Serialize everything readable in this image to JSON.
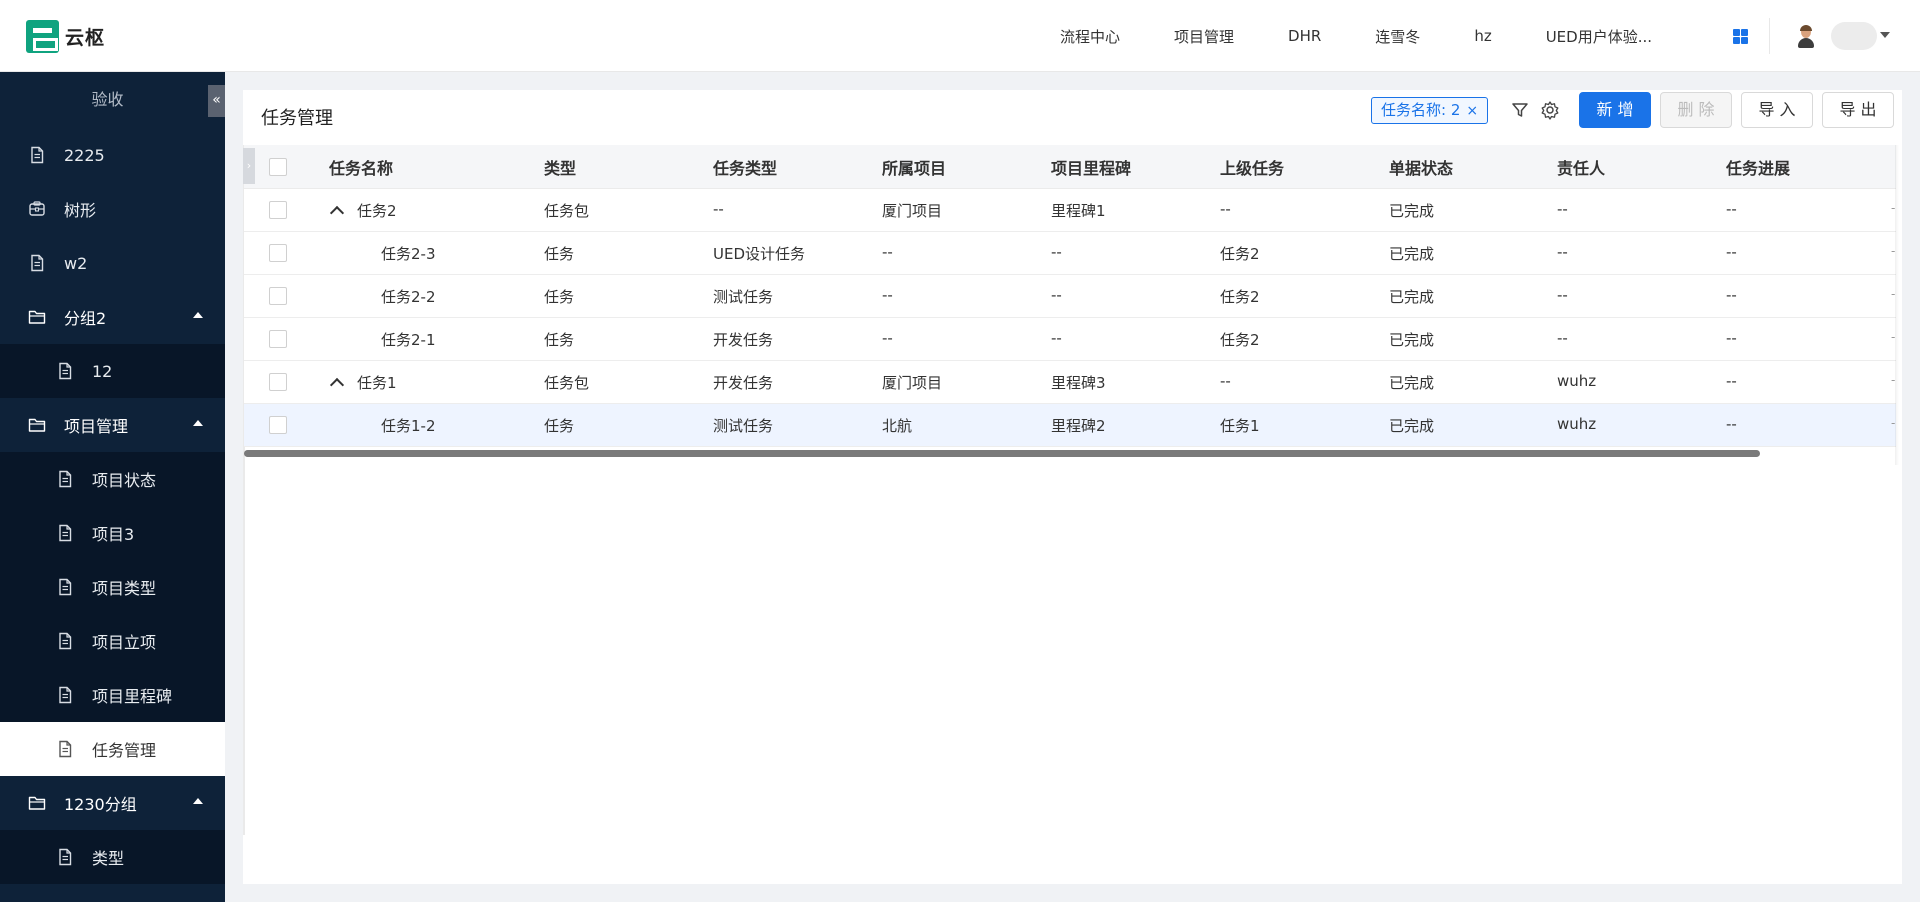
{
  "app": {
    "logo_text": "云枢"
  },
  "topnav": {
    "items": [
      "流程中心",
      "项目管理",
      "DHR",
      "连雪冬",
      "hz",
      "UED用户体验..."
    ]
  },
  "sidebar": {
    "title": "验收",
    "collapse_glyph": "«",
    "items": [
      {
        "label": "2225",
        "icon": "document-icon",
        "level": 0
      },
      {
        "label": "树形",
        "icon": "tree-icon",
        "level": 0
      },
      {
        "label": "w2",
        "icon": "document-icon",
        "level": 0
      },
      {
        "label": "分组2",
        "icon": "folder-icon",
        "level": 0,
        "group": true,
        "expanded": true
      },
      {
        "label": "12",
        "icon": "document-icon",
        "level": 1
      },
      {
        "label": "项目管理",
        "icon": "folder-icon",
        "level": 0,
        "group": true,
        "expanded": true
      },
      {
        "label": "项目状态",
        "icon": "document-icon",
        "level": 1
      },
      {
        "label": "项目3",
        "icon": "document-icon",
        "level": 1
      },
      {
        "label": "项目类型",
        "icon": "document-icon",
        "level": 1
      },
      {
        "label": "项目立项",
        "icon": "document-icon",
        "level": 1
      },
      {
        "label": "项目里程碑",
        "icon": "document-icon",
        "level": 1
      },
      {
        "label": "任务管理",
        "icon": "document-icon",
        "level": 1,
        "active": true
      },
      {
        "label": "1230分组",
        "icon": "folder-icon",
        "level": 0,
        "group": true,
        "expanded": true
      },
      {
        "label": "类型",
        "icon": "document-icon",
        "level": 1
      }
    ]
  },
  "page": {
    "title": "任务管理",
    "filter_chip": "任务名称: 2",
    "filter_chip_close": "×",
    "buttons": {
      "add": "新 增",
      "delete": "删 除",
      "import": "导 入",
      "export": "导 出"
    }
  },
  "table": {
    "columns": [
      "任务名称",
      "类型",
      "任务类型",
      "所属项目",
      "项目里程碑",
      "上级任务",
      "单据状态",
      "责任人",
      "任务进展"
    ],
    "rows": [
      {
        "name": "任务2",
        "type": "任务包",
        "task_type": "--",
        "project": "厦门项目",
        "milestone": "里程碑1",
        "parent": "--",
        "status": "已完成",
        "owner": "--",
        "progress": "--",
        "expandable": true,
        "indent": 0
      },
      {
        "name": "任务2-3",
        "type": "任务",
        "task_type": "UED设计任务",
        "project": "--",
        "milestone": "--",
        "parent": "任务2",
        "status": "已完成",
        "owner": "--",
        "progress": "--",
        "indent": 1
      },
      {
        "name": "任务2-2",
        "type": "任务",
        "task_type": "测试任务",
        "project": "--",
        "milestone": "--",
        "parent": "任务2",
        "status": "已完成",
        "owner": "--",
        "progress": "--",
        "indent": 1
      },
      {
        "name": "任务2-1",
        "type": "任务",
        "task_type": "开发任务",
        "project": "--",
        "milestone": "--",
        "parent": "任务2",
        "status": "已完成",
        "owner": "--",
        "progress": "--",
        "indent": 1
      },
      {
        "name": "任务1",
        "type": "任务包",
        "task_type": "开发任务",
        "project": "厦门项目",
        "milestone": "里程碑3",
        "parent": "--",
        "status": "已完成",
        "owner": "wuhz",
        "progress": "--",
        "expandable": true,
        "indent": 0
      },
      {
        "name": "任务1-2",
        "type": "任务",
        "task_type": "测试任务",
        "project": "北航",
        "milestone": "里程碑2",
        "parent": "任务1",
        "status": "已完成",
        "owner": "wuhz",
        "progress": "--",
        "indent": 1,
        "highlighted": true
      }
    ]
  },
  "colors": {
    "accent": "#1a73e8",
    "sidebar_bg": "#0e2239",
    "sidebar_sub_bg": "#081628",
    "logo": "#0fa37f"
  }
}
